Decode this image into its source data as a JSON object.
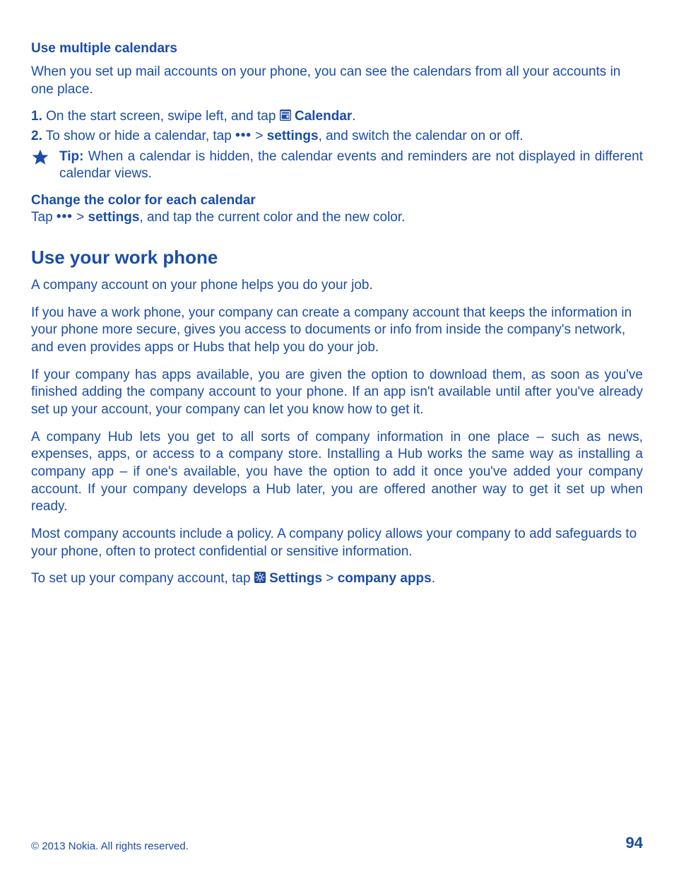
{
  "section1": {
    "heading": "Use multiple calendars",
    "intro": "When you set up mail accounts on your phone, you can see the calendars from all your accounts in one place.",
    "step1_num": "1.",
    "step1_a": " On the start screen, swipe left, and tap ",
    "step1_b": "Calendar",
    "step1_c": ".",
    "step2_num": "2.",
    "step2_a": " To show or hide a calendar, tap ",
    "step2_b": " > ",
    "step2_c": "settings",
    "step2_d": ", and switch the calendar on or off.",
    "more_glyph": "•••",
    "tip_label": "Tip:",
    "tip_text": " When a calendar is hidden, the calendar events and reminders are not displayed in different calendar views.",
    "sub_heading": "Change the color for each calendar",
    "sub_a": "Tap ",
    "sub_b": " > ",
    "sub_c": "settings",
    "sub_d": ", and tap the current color and the new color."
  },
  "section2": {
    "heading": "Use your work phone",
    "p1": "A company account on your phone helps you do your job.",
    "p2": "If you have a work phone, your company can create a company account that keeps the information in your phone more secure, gives you access to documents or info from inside the company's network, and even provides apps or Hubs that help you do your job.",
    "p3": "If your company has apps available, you are given the option to download them, as soon as you've finished adding the company account to your phone. If an app isn't available until after you've already set up your account, your company can let you know how to get it.",
    "p4": "A company Hub lets you get to all sorts of company information in one place – such as news, expenses, apps, or access to a company store. Installing a Hub works the same way as installing a company app – if one's available, you have the option to add it once you've added your company account. If your company develops a Hub later, you are offered another way to get it set up when ready.",
    "p5": "Most company accounts include a policy. A company policy allows your company to add safeguards to your phone, often to protect confidential or sensitive information.",
    "p6_a": "To set up your company account, tap ",
    "p6_b": "Settings",
    "p6_c": " > ",
    "p6_d": "company apps",
    "p6_e": "."
  },
  "footer": {
    "copyright": "© 2013 Nokia. All rights reserved.",
    "page_number": "94"
  }
}
